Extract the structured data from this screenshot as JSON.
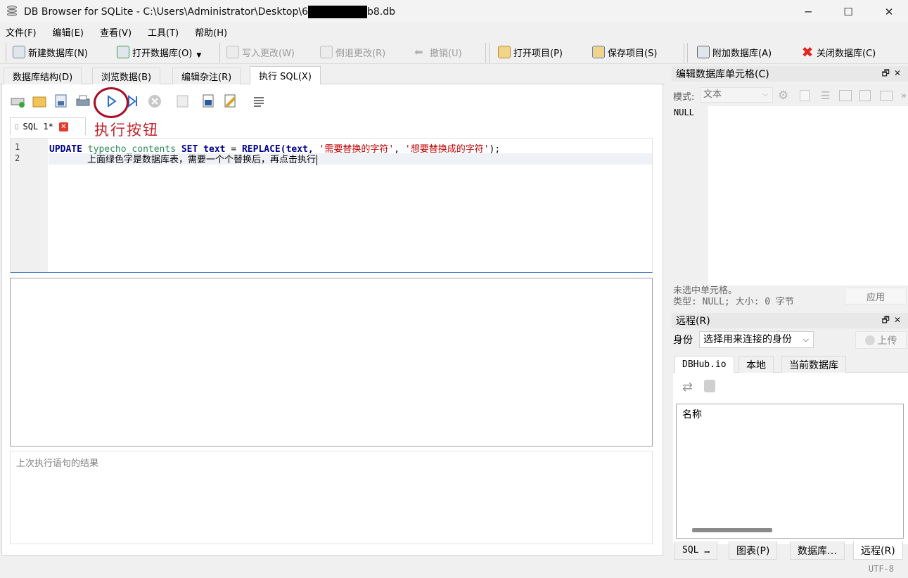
{
  "window": {
    "title_prefix": "DB Browser for SQLite - C:\\Users\\Administrator\\Desktop\\6",
    "title_suffix": "b8.db",
    "minimize": "─",
    "maximize": "☐",
    "close": "✕"
  },
  "menu": [
    "文件(F)",
    "编辑(E)",
    "查看(V)",
    "工具(T)",
    "帮助(H)"
  ],
  "toolbar": {
    "new_db": "新建数据库(N)",
    "open_db": "打开数据库(O)",
    "write_changes": "写入更改(W)",
    "revert_changes": "倒退更改(R)",
    "undo": "撤销(U)",
    "open_project": "打开项目(P)",
    "save_project": "保存项目(S)",
    "attach_db": "附加数据库(A)",
    "close_db": "关闭数据库(C)"
  },
  "tabs": [
    "数据库结构(D)",
    "浏览数据(B)",
    "编辑杂注(R)",
    "执行 SQL(X)"
  ],
  "annotation": "执行按钮",
  "sql_tab": {
    "label": "SQL 1*",
    "close": "✕"
  },
  "editor": {
    "line_numbers": [
      "1",
      "2"
    ],
    "line1": {
      "kw_update": "UPDATE",
      "table": "typecho_contents",
      "kw_set": "SET",
      "col": "text",
      "eq": "=",
      "fn": "REPLACE",
      "args_open": "(text,",
      "str1": "'需要替换的字符'",
      "comma": ",",
      "str2": "'想要替换成的字符'",
      "close": ");"
    },
    "line2": "上面绿色字是数据库表，需要一个个替换后，再点击执行"
  },
  "last_result_placeholder": "上次执行语句的结果",
  "edit_cell": {
    "title": "编辑数据库单元格(C)",
    "dock_buttons": "🗗✕",
    "mode_label": "模式:",
    "mode_value": "文本",
    "value": "NULL",
    "status_line1": "未选中单元格。",
    "status_line2": "类型: NULL; 大小: 0 字节",
    "apply": "应用"
  },
  "remote": {
    "title": "远程(R)",
    "dock_buttons": "🗗✕",
    "identity_label": "身份",
    "identity_placeholder": "选择用来连接的身份",
    "upload": "上传",
    "tabs": [
      "DBHub.io",
      "本地",
      "当前数据库"
    ],
    "column_name": "名称"
  },
  "bottom_tabs": [
    "SQL …",
    "图表(P)",
    "数据库…",
    "远程(R)"
  ],
  "status": {
    "encoding": "UTF-8"
  }
}
